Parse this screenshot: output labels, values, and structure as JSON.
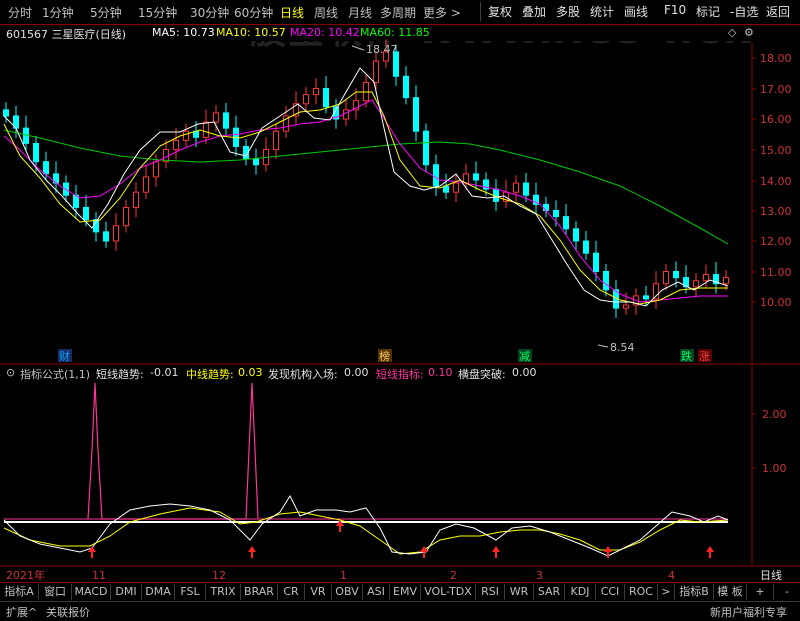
{
  "toolbar": {
    "periods": [
      "分时",
      "1分钟",
      "5分钟",
      "15分钟",
      "30分钟",
      "60分钟",
      "日线",
      "周线",
      "月线",
      "多周期",
      "更多 >"
    ],
    "active_period": "日线",
    "right": [
      "复权",
      "叠加",
      "多股",
      "统计",
      "画线",
      "F10",
      "标记",
      "-自选",
      "返回"
    ]
  },
  "watermark": "股宝软件 WWW.XGS T.CN",
  "price_header": {
    "title": "601567 三星医疗(日线)",
    "ma5": "MA5: 10.73",
    "ma10": "MA10: 10.57",
    "ma20": "MA20: 10.42",
    "ma60": "MA60: 11.85"
  },
  "colors": {
    "ma5": "#ffffff",
    "ma10": "#ffff00",
    "ma20": "#ff00ff",
    "ma60": "#00ff00",
    "up": "#ff3333",
    "down": "#00ffff",
    "axis": "#8b0000"
  },
  "price_axis": {
    "ticks": [
      "18.00",
      "17.00",
      "16.00",
      "15.00",
      "14.00",
      "13.00",
      "12.00",
      "11.00",
      "10.00"
    ]
  },
  "annotations": {
    "high": "18.47",
    "low": "8.54"
  },
  "markers": [
    {
      "text": "财",
      "color": "#00aaff",
      "bg": "#1a2a66"
    },
    {
      "text": "榜",
      "color": "#ffcc66",
      "bg": "#553300"
    },
    {
      "text": "减",
      "color": "#00ff66",
      "bg": "#004422"
    },
    {
      "text": "跌",
      "color": "#00ff66",
      "bg": "#004422"
    },
    {
      "text": "涨",
      "color": "#ff4444",
      "bg": "#550000"
    }
  ],
  "indicator_header": {
    "name": "指标公式(1,1)",
    "short_label": "短线趋势:",
    "short_val": "-0.01",
    "mid_label": "中线趋势:",
    "mid_val": "0.03",
    "inst_label": "发现机构入场:",
    "inst_val": "0.00",
    "shortind_label": "短线指标:",
    "shortind_val": "0.10",
    "break_label": "横盘突破:",
    "break_val": "0.00"
  },
  "indicator_axis": {
    "ticks": [
      "2.00",
      "1.00"
    ]
  },
  "date_axis": {
    "labels": [
      "2021年",
      "11",
      "12",
      "1",
      "2",
      "3",
      "4"
    ],
    "period": "日线"
  },
  "tabs": [
    "指标A",
    "窗口",
    "MACD",
    "DMI",
    "DMA",
    "FSL",
    "TRIX",
    "BRAR",
    "CR",
    "VR",
    "OBV",
    "ASI",
    "EMV",
    "VOL-TDX",
    "RSI",
    "WR",
    "SAR",
    "KDJ",
    "CCI",
    "ROC",
    ">",
    "指标B",
    "模 板",
    "+",
    "-"
  ],
  "bottom": {
    "left1": "扩展^",
    "left2": "关联报价",
    "right": "新用户福利专享"
  }
}
